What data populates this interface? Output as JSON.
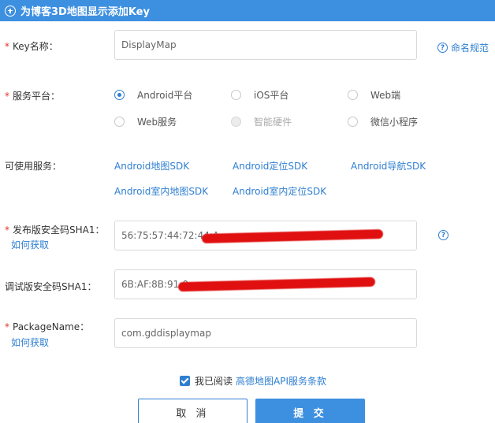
{
  "header": {
    "title": "为博客3D地图显示添加Key"
  },
  "form": {
    "key_name": {
      "label": "Key名称：",
      "value": "DisplayMap",
      "help": "命名规范"
    },
    "platform": {
      "label": "服务平台：",
      "options": [
        {
          "label": "Android平台",
          "state": "checked"
        },
        {
          "label": "iOS平台",
          "state": "unchecked"
        },
        {
          "label": "Web端",
          "state": "unchecked"
        },
        {
          "label": "Web服务",
          "state": "unchecked"
        },
        {
          "label": "智能硬件",
          "state": "disabled"
        },
        {
          "label": "微信小程序",
          "state": "unchecked"
        }
      ]
    },
    "services": {
      "label": "可使用服务：",
      "items": [
        "Android地图SDK",
        "Android定位SDK",
        "Android导航SDK",
        "Android室内地图SDK",
        "Android室内定位SDK"
      ]
    },
    "release_sha1": {
      "label": "发布版安全码SHA1：",
      "value": "56:75:57:44:72:44:A",
      "howto": "如何获取",
      "help_glyph": "?"
    },
    "debug_sha1": {
      "label": "调试版安全码SHA1：",
      "value": "6B:AF:8B:91:0"
    },
    "package_name": {
      "label": "PackageName：",
      "value": "com.gddisplaymap",
      "howto": "如何获取"
    },
    "required_mark": "*"
  },
  "agreement": {
    "text": "我已阅读",
    "link": "高德地图API服务条款",
    "checked": true
  },
  "buttons": {
    "cancel": "取 消",
    "submit": "提 交"
  },
  "colors": {
    "accent": "#3d8fe0",
    "link": "#2f7fd0",
    "required": "#e2302a"
  }
}
